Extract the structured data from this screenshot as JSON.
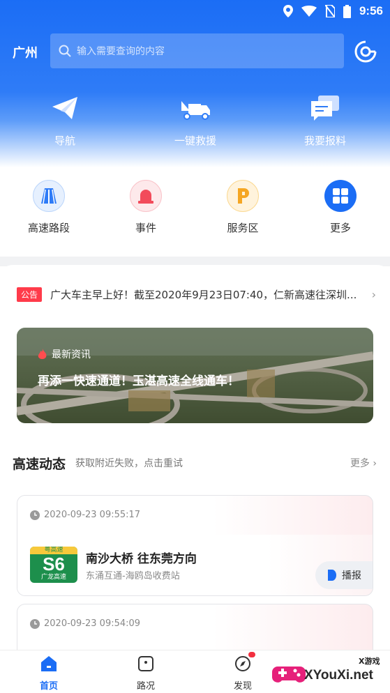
{
  "status_bar": {
    "time": "9:56"
  },
  "header": {
    "city": "广州",
    "search_placeholder": "输入需要查询的内容",
    "quick_actions": [
      {
        "label": "导航",
        "icon": "paper-plane-icon"
      },
      {
        "label": "一键救援",
        "icon": "tow-truck-icon"
      },
      {
        "label": "我要报料",
        "icon": "chat-report-icon"
      }
    ]
  },
  "categories": [
    {
      "label": "高速路段",
      "icon": "highway-icon",
      "color": "#2f7cf7"
    },
    {
      "label": "事件",
      "icon": "alarm-light-icon",
      "color": "#f24b5b"
    },
    {
      "label": "服务区",
      "icon": "parking-p-icon",
      "color": "#f5a623"
    },
    {
      "label": "更多",
      "icon": "grid-icon",
      "color": "#1b6df5"
    }
  ],
  "notice": {
    "badge": "公告",
    "text": "广大车主早上好！截至2020年9月23日07:40，仁新高速往深圳..."
  },
  "banner": {
    "tag": "最新资讯",
    "title": "再添一快速通道！玉湛高速全线通车！"
  },
  "section": {
    "title": "高速动态",
    "subtitle": "获取附近失败，点击重试",
    "more": "更多"
  },
  "events": [
    {
      "time": "2020-09-23 09:55:17",
      "shield_top": "粤高速",
      "shield_code": "S6",
      "shield_bottom": "广龙高速",
      "road": "南沙大桥 往东莞方向",
      "segment": "东涌互通-海鸥岛收费站",
      "play_label": "播报"
    },
    {
      "time": "2020-09-23 09:54:09"
    }
  ],
  "tabbar": [
    {
      "label": "首页",
      "icon": "home-icon",
      "active": true
    },
    {
      "label": "路况",
      "icon": "road-condition-icon",
      "active": false
    },
    {
      "label": "发现",
      "icon": "compass-icon",
      "active": false
    }
  ],
  "watermark": {
    "site": "XYouXi.net",
    "small": "X游戏"
  }
}
